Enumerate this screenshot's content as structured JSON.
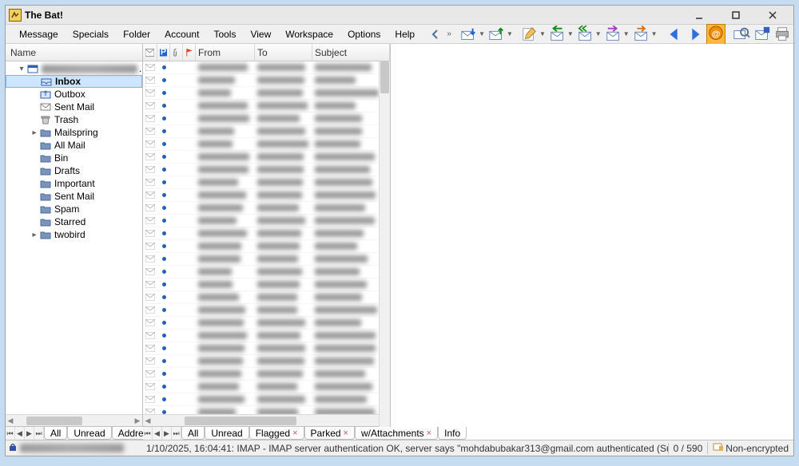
{
  "title": "The Bat!",
  "menus": [
    "Message",
    "Specials",
    "Folder",
    "Account",
    "Tools",
    "View",
    "Workspace",
    "Options",
    "Help"
  ],
  "folder_header": "Name",
  "tree": [
    {
      "level": 0,
      "caret": "▾",
      "icon": "account",
      "label": "",
      "blurred": true,
      "selected": false
    },
    {
      "level": 1,
      "caret": "",
      "icon": "inbox",
      "label": "Inbox",
      "selected": true
    },
    {
      "level": 1,
      "caret": "",
      "icon": "outbox",
      "label": "Outbox"
    },
    {
      "level": 1,
      "caret": "",
      "icon": "sent",
      "label": "Sent Mail"
    },
    {
      "level": 1,
      "caret": "",
      "icon": "trash",
      "label": "Trash"
    },
    {
      "level": 1,
      "caret": "▸",
      "icon": "folder",
      "label": "Mailspring"
    },
    {
      "level": 1,
      "caret": "",
      "icon": "folder",
      "label": "All Mail"
    },
    {
      "level": 1,
      "caret": "",
      "icon": "folder",
      "label": "Bin"
    },
    {
      "level": 1,
      "caret": "",
      "icon": "folder",
      "label": "Drafts"
    },
    {
      "level": 1,
      "caret": "",
      "icon": "folder",
      "label": "Important"
    },
    {
      "level": 1,
      "caret": "",
      "icon": "folder",
      "label": "Sent Mail"
    },
    {
      "level": 1,
      "caret": "",
      "icon": "folder",
      "label": "Spam"
    },
    {
      "level": 1,
      "caret": "",
      "icon": "folder",
      "label": "Starred"
    },
    {
      "level": 1,
      "caret": "▸",
      "icon": "folder",
      "label": "twobird"
    }
  ],
  "msg_cols": {
    "from": "From",
    "to": "To",
    "subject": "Subject"
  },
  "msg_count_visible_rows": 28,
  "folder_tabs": {
    "items": [
      {
        "label": "All",
        "active": true
      },
      {
        "label": "Unread"
      },
      {
        "label": "Addresse"
      }
    ]
  },
  "msg_tabs": {
    "items": [
      {
        "label": "All",
        "active": true
      },
      {
        "label": "Unread"
      },
      {
        "label": "Flagged",
        "closable": true
      },
      {
        "label": "Parked",
        "closable": true
      },
      {
        "label": "w/Attachments",
        "closable": true
      },
      {
        "label": "Info",
        "partial": true
      }
    ]
  },
  "status": {
    "text": "1/10/2025, 16:04:41: IMAP  - IMAP server authentication OK, server says \"mohdabubakar313@gmail.com authenticated (Success)\"",
    "counter": "0 / 590",
    "encryption": "Non-encrypted"
  }
}
